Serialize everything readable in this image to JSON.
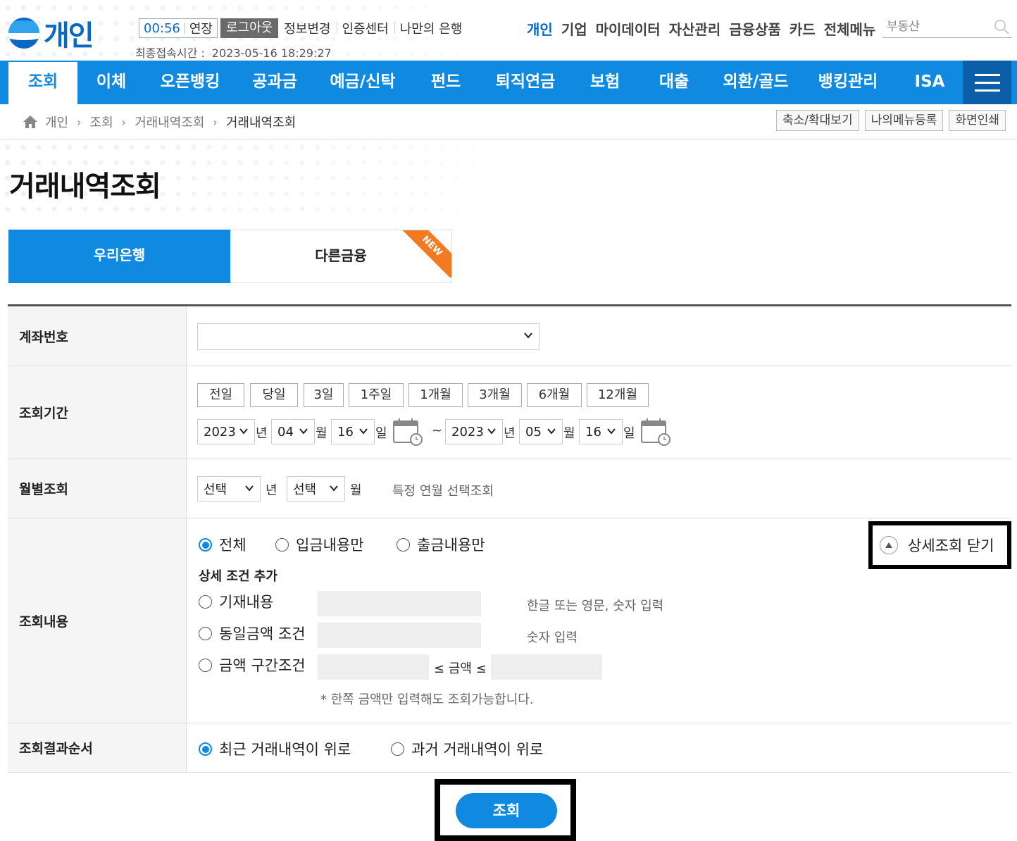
{
  "header": {
    "logo_text": "개인",
    "timer": "00:56",
    "extend_label": "연장",
    "logout_label": "로그아웃",
    "util_links": [
      "정보변경",
      "인증센터",
      "나만의 은행"
    ],
    "last_login_label": "최종접속시간 :",
    "last_login_value": "2023-05-16 18:29:27",
    "gnb": [
      "개인",
      "기업",
      "마이데이터",
      "자산관리",
      "금융상품",
      "카드",
      "전체메뉴"
    ],
    "search_placeholder": "부동산"
  },
  "nav": {
    "items": [
      "조회",
      "이체",
      "오픈뱅킹",
      "공과금",
      "예금/신탁",
      "펀드",
      "퇴직연금",
      "보험",
      "대출",
      "외환/골드",
      "뱅킹관리",
      "ISA"
    ],
    "active": "조회"
  },
  "breadcrumb": [
    "개인",
    "조회",
    "거래내역조회",
    "거래내역조회"
  ],
  "tools": [
    "축소/확대보기",
    "나의메뉴등록",
    "화면인쇄"
  ],
  "page_title": "거래내역조회",
  "tabs": {
    "woori": "우리은행",
    "other": "다른금융",
    "new_badge": "NEW"
  },
  "form": {
    "account_label": "계좌번호",
    "account_value": "",
    "period_label": "조회기간",
    "period_buttons": [
      "전일",
      "당일",
      "3일",
      "1주일",
      "1개월",
      "3개월",
      "6개월",
      "12개월"
    ],
    "from": {
      "year": "2023",
      "month": "04",
      "day": "16"
    },
    "to": {
      "year": "2023",
      "month": "05",
      "day": "16"
    },
    "unit_year": "년",
    "unit_month": "월",
    "unit_day": "일",
    "tilde": "~",
    "monthly_label": "월별조회",
    "monthly_year": "선택",
    "monthly_month": "선택",
    "monthly_hint": "특정 연월 선택조회",
    "content_label": "조회내용",
    "content_options": [
      "전체",
      "입금내용만",
      "출금내용만"
    ],
    "detail_close": "상세조회 닫기",
    "detail_heading": "상세 조건 추가",
    "detail_options": [
      "기재내용",
      "동일금액 조건",
      "금액 구간조건"
    ],
    "hint_text": "한글 또는 영문, 숫자 입력",
    "hint_number": "숫자 입력",
    "amount_range": "≤ 금액 ≤",
    "note": "* 한쪽 금액만 입력해도 조회가능합니다.",
    "order_label": "조회결과순서",
    "order_options": [
      "최근 거래내역이 위로",
      "과거 거래내역이 위로"
    ]
  },
  "submit_label": "조회",
  "colors": {
    "primary": "#0f8ae0",
    "logo": "#0a67c2",
    "badge": "#f27a21"
  }
}
